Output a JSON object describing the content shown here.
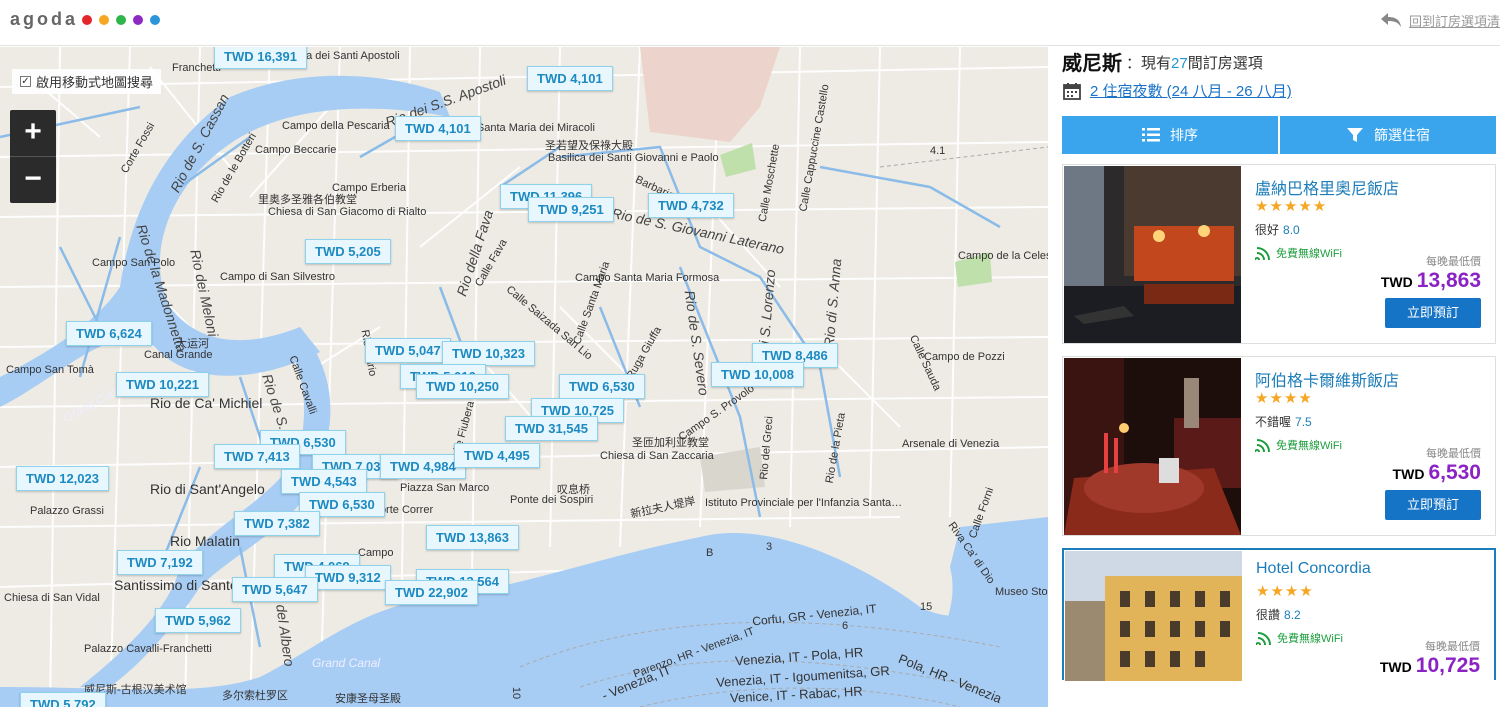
{
  "brand": {
    "name": "agoda",
    "dot_colors": [
      "#e2262a",
      "#f5a623",
      "#2eb54b",
      "#8d2ac4",
      "#2b95d9"
    ]
  },
  "header": {
    "back_label": "回到訂房選項清"
  },
  "map": {
    "checkbox_label": "啟用移動式地圖搜尋",
    "zoom_in": "+",
    "zoom_out": "−",
    "price_pins": [
      "TWD 16,391",
      "TWD 4,101",
      "TWD 4,101",
      "TWD 11,396",
      "TWD 9,251",
      "TWD 4,732",
      "TWD 5,205",
      "TWD 6,624",
      "TWD 5,047",
      "TWD 10,323",
      "TWD 8,486",
      "TWD 10,008",
      "TWD 5,016",
      "TWD 10,250",
      "TWD 10,221",
      "TWD 6,530",
      "TWD 10,725",
      "TWD 31,545",
      "TWD 6,530",
      "TWD 7,413",
      "TWD 7,035",
      "TWD 4,984",
      "TWD 4,495",
      "TWD 12,023",
      "TWD 4,543",
      "TWD 6,530",
      "TWD 7,382",
      "TWD 13,863",
      "TWD 7,192",
      "TWD 4,069",
      "TWD 9,312",
      "TWD 13,564",
      "TWD 5,647",
      "TWD 22,902",
      "TWD 5,962",
      "TWD 5,792"
    ],
    "place_labels": [
      "Franchetti",
      "Chiesa dei Santi Apostoli",
      "Rio dei S.S. Apostoli",
      "Campo della Pescaria",
      "Campo Beccarie",
      "Rio de S. Cassan",
      "Corte Fossi",
      "Rio de le Botteri",
      "Rio de la Madonnetta",
      "Rio dei Meloni",
      "Campo San Polo",
      "Campo di San Silvestro",
      "Campo Erberia",
      "里奥多圣雅各伯教堂",
      "Chiesa di San Giacomo di Rialto",
      "Chiesa di Santa Maria dei Miracoli",
      "圣若望及保祿大殿",
      "Basilica dei Santi Giovanni e Paolo",
      "Campo Santa Maria Formosa",
      "Calle Santa Maria",
      "Rio de S. Giovanni Laterano",
      "Calle Moschette",
      "Calle Cappuccine Castello",
      "Rio di S. Anna",
      "Campo de la Celestia",
      "Campo de Pozzi",
      "Rio de S. Severo",
      "Rio di S. Lorenzo",
      "Campo S. Provolo",
      "Arsenale di Venezia",
      "圣匝加利亚教堂",
      "Chiesa di San Zaccaria",
      "叹息桥",
      "Ponte dei Sospiri",
      "新拉夫人堤岸",
      "Istituto Provinciale per l'Infanzia Santa…",
      "Piazza San Marco",
      "Rio della Fava",
      "Calle Fava",
      "Calle Saizada San Lio",
      "Ruga Giuffa",
      "Calle Fiubera",
      "大运河",
      "Canal Grande",
      "Campo San Tomà",
      "Grand Canal",
      "Rio de S. Luca",
      "Calle Cavalli",
      "Rio de Ca' Michiel",
      "Rio di Sant'Angelo",
      "Rio Malatin",
      "Santissimo di Santo Stefano",
      "Chiesa di San Vidal",
      "Rio del Albero",
      "Palazzo Cavalli-Franchetti",
      "Palazzo Grassi",
      "Grand Canal",
      "威尼斯-古根汉美术馆",
      "多尔索杜罗区",
      "安康圣母圣殿",
      "Corte Correr",
      "Campo",
      "Corfu, GR - Venezia, IT",
      "Venezia, IT - Pola, HR",
      "Venezia, IT - Igoumenitsa, GR",
      "Venice, IT - Rabac, HR",
      "Pola, HR - Venezia",
      "Parenzo, HR - Venezia, IT",
      "- Venezia, IT",
      "Museo Storico Navale di Venezia",
      "Riva Ca' di Dio",
      "Calle Forni",
      "Rio del Greci",
      "Rio de la Pieta",
      "Calle Sauda",
      "Rio Mario",
      "Barbarie",
      "4.1",
      "15",
      "B",
      "6",
      "10",
      "3"
    ]
  },
  "panel": {
    "city": "威尼斯",
    "count_prefix": "：現有",
    "count": "27",
    "count_suffix": "間訂房選項",
    "dates": "2 住宿夜數 (24 八月 - 26 八月)",
    "sort_label": "排序",
    "filter_label": "篩選住宿",
    "hotels": [
      {
        "name": "盧納巴格里奧尼飯店",
        "stars": "★★★★★",
        "rating_text": "很好",
        "rating": "8.0",
        "wifi": "免費無線WiFi",
        "lowest": "每晚最低價",
        "currency": "TWD",
        "price": "13,863",
        "book": "立即預訂"
      },
      {
        "name": "阿伯格卡爾維斯飯店",
        "stars": "★★★★",
        "rating_text": "不錯喔",
        "rating": "7.5",
        "wifi": "免費無線WiFi",
        "lowest": "每晚最低價",
        "currency": "TWD",
        "price": "6,530",
        "book": "立即預訂"
      },
      {
        "name": "Hotel Concordia",
        "stars": "★★★★",
        "rating_text": "很讚",
        "rating": "8.2",
        "wifi": "免費無線WiFi",
        "lowest": "每晚最低價",
        "currency": "TWD",
        "price": "10,725"
      }
    ]
  }
}
